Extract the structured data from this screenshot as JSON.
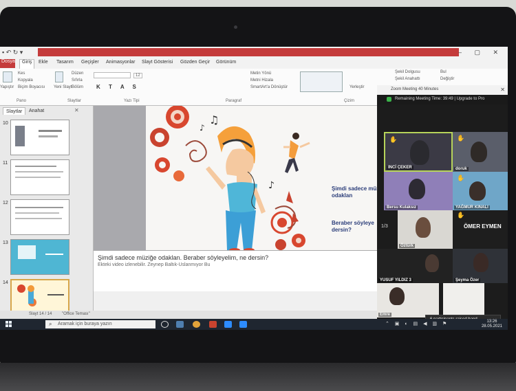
{
  "ppt": {
    "file_tab": "Dosya",
    "tabs": [
      "Giriş",
      "Ekle",
      "Tasarım",
      "Geçişler",
      "Animasyonlar",
      "Slayt Gösterisi",
      "Gözden Geçir",
      "Görünüm"
    ],
    "clipboard": {
      "paste": "Yapıştır",
      "cut": "Kes",
      "copy": "Kopyala",
      "format_painter": "Biçim Boyacısı",
      "group": "Pano"
    },
    "slides_group": {
      "new_slide": "Yeni Slayt",
      "layout": "Düzen",
      "reset": "Sıfırla",
      "section": "Bölüm",
      "group": "Slaytlar"
    },
    "font_group": {
      "font_size": "12",
      "group": "Yazı Tipi"
    },
    "paragraph_group": {
      "direction": "Metin Yönü",
      "align": "Metni Hizala",
      "smartart": "SmartArt'a Dönüştür",
      "group": "Paragraf"
    },
    "drawing_group": {
      "arrange": "Yerleştir",
      "quick_styles": "Hızlı Stiller",
      "fill": "Şekil Dolgusu",
      "outline": "Şekil Anahattı",
      "group": "Çizim"
    },
    "editing_group": {
      "find": "Bul",
      "replace": "Değiştir"
    },
    "panel": {
      "tab_slides": "Slaytlar",
      "tab_outline": "Anahat",
      "slide_numbers": [
        "10",
        "11",
        "12",
        "13",
        "14"
      ]
    },
    "slide": {
      "line1a": "Şimdi sadece müz",
      "line1b": "odaklan",
      "line2a": "Beraber söyleye",
      "line2b": "dersin?"
    },
    "notes": {
      "line1": "Şimdi sadece müziğe odaklan. Beraber söyleyelim, ne dersin?",
      "line2": "Ekteki video izlenebilir. Zeynep Baltık-Uslanmıyor Bu"
    },
    "status": {
      "slide": "Slayt 14 / 14",
      "theme": "\"Office Teması\""
    }
  },
  "zoom": {
    "window_title": "Zoom Meeting 40 Minutes",
    "remaining": "Remaining Meeting Time: 39:49 | Upgrade to Pro",
    "page": "1/3",
    "participants": [
      {
        "name": "INCİ ÇEKER",
        "hand": true
      },
      {
        "name": "doruk",
        "hand": true
      },
      {
        "name": "Bersu Kulaksız",
        "hand": false
      },
      {
        "name": "YAĞMUR KINALI",
        "hand": true
      },
      {
        "name": "Öztürk",
        "hand": false
      },
      {
        "name": "ÖMER EYMEN",
        "hand": true
      },
      {
        "name": "YUSUF YILDIZ 3",
        "hand": false
      },
      {
        "name": "Şeyma Özer",
        "hand": false
      },
      {
        "name": "Emre",
        "hand": false
      }
    ],
    "toast": "6 participants raised hand"
  },
  "taskbar": {
    "search_placeholder": "Aramak için buraya yazın",
    "time": "13:26",
    "date": "28.05.2021"
  },
  "colors": {
    "ppt_accent": "#c43b3b",
    "zoom_bg": "#1c1c1c",
    "active_speaker": "#b7d45a",
    "taskbar": "#1f2630"
  },
  "icons": [
    "search-icon",
    "windows-start-icon",
    "shield-icon",
    "raised-hand-icon",
    "close-icon"
  ]
}
